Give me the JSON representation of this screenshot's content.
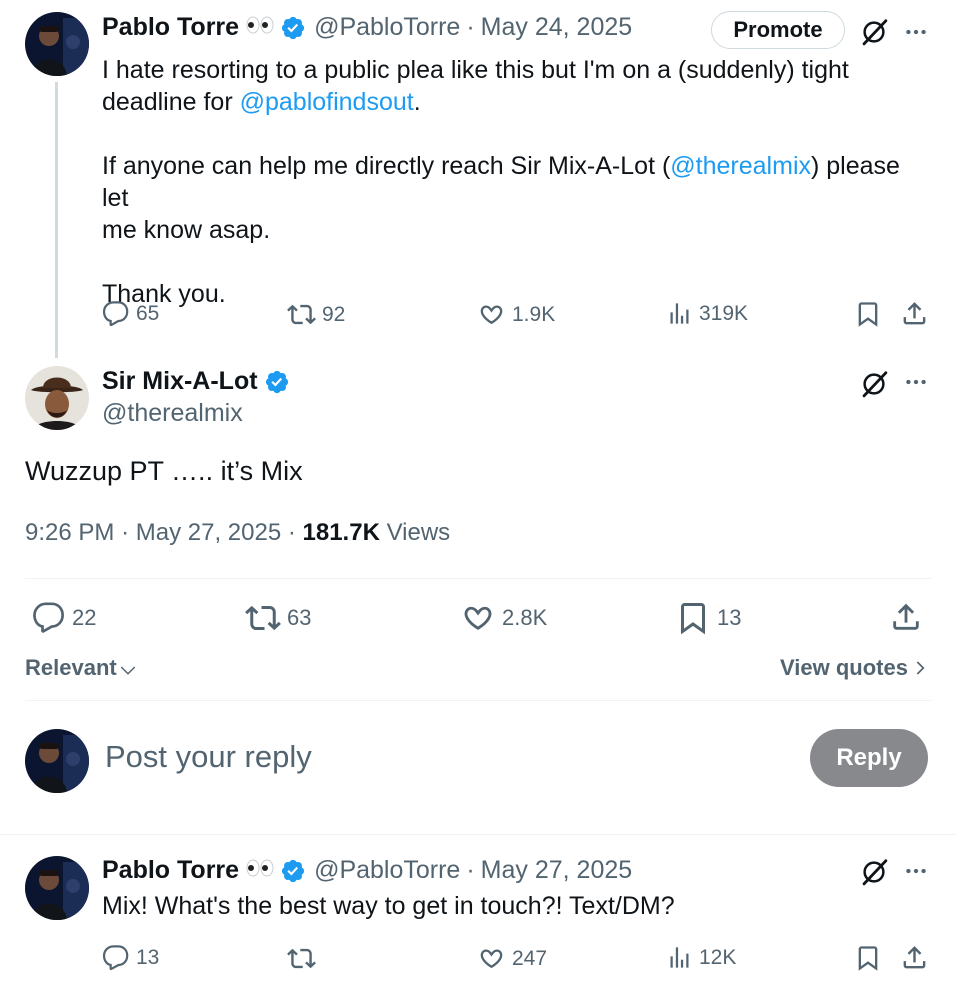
{
  "tweet1": {
    "author_name": "Pablo Torre",
    "author_emoji": "👀",
    "author_handle": "@PabloTorre",
    "date": "May 24, 2025",
    "promote_label": "Promote",
    "text_line1": "I hate resorting to a public plea like this but I'm on a (suddenly) tight",
    "text_line2_pre": "deadline for ",
    "text_line2_link": "@pablofindsout",
    "text_line2_post": ".",
    "text_p2_pre": "If anyone can help me directly reach Sir Mix-A-Lot (",
    "text_p2_link": "@therealmix",
    "text_p2_post": ") please let",
    "text_p2_line2": "me know asap.",
    "text_p3": "Thank you.",
    "replies": "65",
    "reposts": "92",
    "likes": "1.9K",
    "views": "319K"
  },
  "main_tweet": {
    "author_name": "Sir Mix-A-Lot",
    "author_handle": "@therealmix",
    "text": "Wuzzup PT ….. it’s Mix",
    "time": "9:26 PM",
    "date": "May 27, 2025",
    "views_count": "181.7K",
    "views_label": "Views",
    "replies": "22",
    "reposts": "63",
    "likes": "2.8K",
    "bookmarks": "13"
  },
  "controls": {
    "sort_label": "Relevant",
    "view_quotes_label": "View quotes",
    "reply_placeholder": "Post your reply",
    "reply_button": "Reply"
  },
  "reply_tweet": {
    "author_name": "Pablo Torre",
    "author_emoji": "👀",
    "author_handle": "@PabloTorre",
    "date": "May 27, 2025",
    "text": "Mix! What's the best way to get in touch?! Text/DM?",
    "replies": "13",
    "likes": "247",
    "views": "12K"
  },
  "colors": {
    "link": "#1d9bf0",
    "secondary_text": "#536471",
    "verified": "#1d9bf0",
    "reply_button_bg": "#87898c"
  }
}
